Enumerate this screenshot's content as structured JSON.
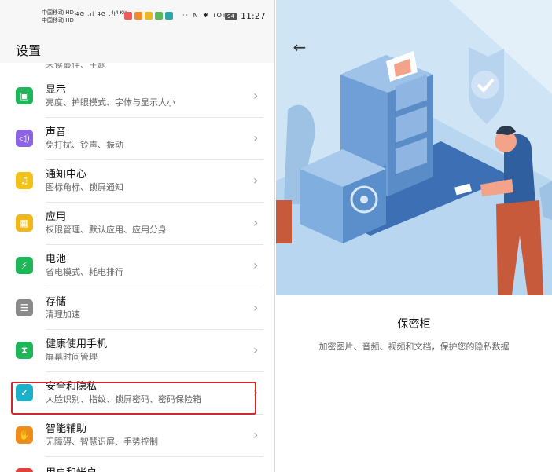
{
  "status_bar": {
    "carrier_1": "中国移动 HD",
    "carrier_2": "中国移动 HD",
    "network": "4G .ıl 4G .ıl",
    "speed": "4.4 K/s",
    "system_icons": "·· N ✱ ıOı",
    "battery": "94",
    "time": "11:27"
  },
  "page": {
    "title": "设置"
  },
  "partial_top_item": "未读最佳、主题",
  "items": [
    {
      "title": "显示",
      "subtitle": "亮度、护眼模式、字体与显示大小",
      "icon": "display-icon",
      "color": "#1fb65a",
      "glyph": "▣"
    },
    {
      "title": "声音",
      "subtitle": "免打扰、铃声、振动",
      "icon": "sound-icon",
      "color": "#8d63e6",
      "glyph": "◁)"
    },
    {
      "title": "通知中心",
      "subtitle": "图标角标、锁屏通知",
      "icon": "bell-icon",
      "color": "#f2c21a",
      "glyph": "♫"
    },
    {
      "title": "应用",
      "subtitle": "权限管理、默认应用、应用分身",
      "icon": "apps-icon",
      "color": "#f2b81a",
      "glyph": "▦"
    },
    {
      "title": "电池",
      "subtitle": "省电模式、耗电排行",
      "icon": "battery-icon",
      "color": "#1fb65a",
      "glyph": "⚡"
    },
    {
      "title": "存储",
      "subtitle": "清理加速",
      "icon": "storage-icon",
      "color": "#8a8a8a",
      "glyph": "☰"
    },
    {
      "title": "健康使用手机",
      "subtitle": "屏幕时间管理",
      "icon": "hourglass-icon",
      "color": "#1fb65a",
      "glyph": "⧗"
    },
    {
      "title": "安全和隐私",
      "subtitle": "人脸识别、指纹、锁屏密码、密码保险箱",
      "icon": "shield-icon",
      "color": "#1fb0c9",
      "glyph": "✓"
    },
    {
      "title": "智能辅助",
      "subtitle": "无障碍、智慧识屏、手势控制",
      "icon": "hand-icon",
      "color": "#f08d1a",
      "glyph": "✋"
    }
  ],
  "partial_bottom_item": "用户和帐户",
  "detail": {
    "title": "保密柜",
    "description": "加密图片、音频、视频和文档，保护您的隐私数据"
  },
  "colors": {
    "highlight": "#d0282d",
    "hero_bg": "#cfe4f5",
    "cabinet": "#6f9fd6"
  }
}
